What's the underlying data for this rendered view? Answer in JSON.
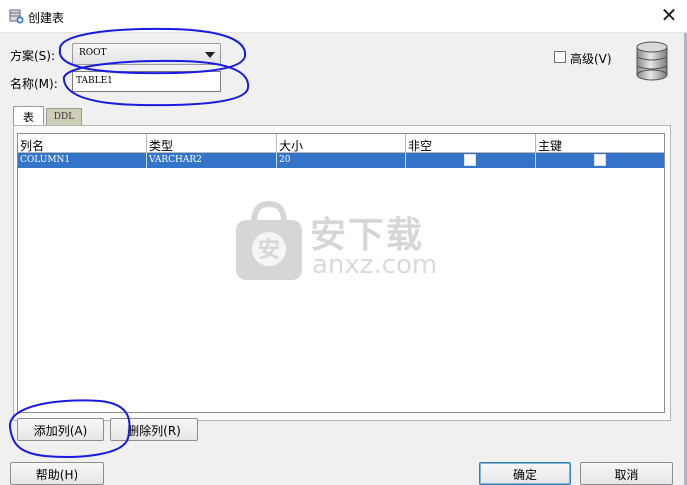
{
  "window": {
    "title": "创建表",
    "close_glyph": "✕"
  },
  "form": {
    "schema_label": "方案(S):",
    "schema_value": "ROOT",
    "name_label": "名称(M):",
    "name_value": "TABLE1",
    "advanced_label": "高级(V)",
    "advanced_checked": false
  },
  "tabs": [
    {
      "label": "表",
      "active": true
    },
    {
      "label": "DDL",
      "active": false
    }
  ],
  "columns_table": {
    "headers": [
      "列名",
      "类型",
      "大小",
      "非空",
      "主键"
    ],
    "rows": [
      {
        "name": "COLUMN1",
        "type": "VARCHAR2",
        "size": "20",
        "not_null": false,
        "primary_key": false,
        "selected": true
      }
    ]
  },
  "watermark": {
    "text": "安下载",
    "domain": "anxz.com",
    "color": "#d0d0d0"
  },
  "buttons": {
    "add_column": "添加列(A)",
    "delete_column": "删除列(R)",
    "help": "帮助(H)",
    "ok": "确定",
    "cancel": "取消"
  },
  "colors": {
    "selection": "#3374c8",
    "annotation": "#1a1ae0",
    "window_bg": "#f0f0f0"
  }
}
